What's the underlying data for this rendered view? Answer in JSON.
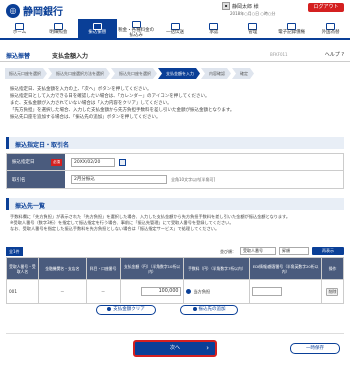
{
  "header": {
    "bank_name": "静岡銀行",
    "user_name": "静岡太郎 様",
    "user_meta": "2018年○月○日 ○時○分",
    "logout_label": "ログアウト"
  },
  "nav": [
    {
      "label": "ホーム",
      "active": false
    },
    {
      "label": "明細照会",
      "active": false
    },
    {
      "label": "振込振替",
      "active": true
    },
    {
      "label": "税金・各種料金の払込み",
      "active": false
    },
    {
      "label": "一括伝送",
      "active": false
    },
    {
      "label": "承認",
      "active": false
    },
    {
      "label": "管理",
      "active": false
    },
    {
      "label": "電子記録債権",
      "active": false
    },
    {
      "label": "外国為替",
      "active": false
    }
  ],
  "title": {
    "small": "振込振替",
    "main": "支払金額入力",
    "screen_id": "BFKF011",
    "help": "ヘルプ"
  },
  "steps": [
    {
      "label": "振込元口座を選択",
      "current": false
    },
    {
      "label": "振込先口座選択方法を選択",
      "current": false
    },
    {
      "label": "振込先口座を選択",
      "current": false
    },
    {
      "label": "支払金額を入力",
      "current": true
    },
    {
      "label": "内容確認",
      "current": false
    },
    {
      "label": "確定",
      "current": false
    }
  ],
  "intro_lines": [
    "振込指定日、支払金額を入力の上、「次へ」ボタンを押してください。",
    "振込指定日として入力できる日を確認したい場合は、「カレンダー」のアイコンを押してください。",
    "また、支払金額が入力されていない場合は「入力内容をクリア」してください。",
    "「先方負担」を選択した場合、入力した支払金額から先方負担手数料を差し引いた金額が振込金額となります。",
    "振込先口座を追加する場合は、「振込先の追加」ボタンを押してください。"
  ],
  "section_date": "振込指定日・取引名",
  "form": {
    "date_label": "振込指定日",
    "required_label": "必須",
    "date_value": "20XX/02/20",
    "name_label": "取引名",
    "name_value": "2月分振込",
    "name_note": "全角10文字以内[半角可]"
  },
  "section_list": "振込先一覧",
  "list_text": [
    "手数料欄に「先方負担」が表示された「先方負担」を選択した場合、入力した支払金額から先方負担手数料を差し引いた金額が振込金額となります。",
    "※受取人番号（数字3桁）を指定して振込指定を行う場合、事前に「振込先管理」にて受取人番号を登録してください。",
    "なお、受取人番号を指定した振込手数料を先方負担としない場合は「振込指定サービス」で処理してください。"
  ],
  "table": {
    "all_badge": "全1件",
    "sort_label": "並び順：",
    "sort_key": "受取人番号",
    "sort_order": "昇順",
    "sort_button": "再表示",
    "headers": [
      "受取人番号・受取人名",
      "金融機関名・支店名",
      "科目・口座番号",
      "支払金額（円）（半角数字10桁以内）",
      "手数料（円）（半角数字7桁以内）",
      "EDI情報/顧客番号（半角英数字20桁以内）",
      "操作"
    ],
    "rows": [
      {
        "num": "001",
        "bank": "－",
        "account": "－",
        "amount": "100,000",
        "fee_option": "当方負担",
        "edi": "",
        "action": "削除"
      }
    ]
  },
  "buttons": {
    "clear": "支払金額クリア",
    "add": "振込先の追加",
    "next": "次へ",
    "save": "一時保存"
  }
}
